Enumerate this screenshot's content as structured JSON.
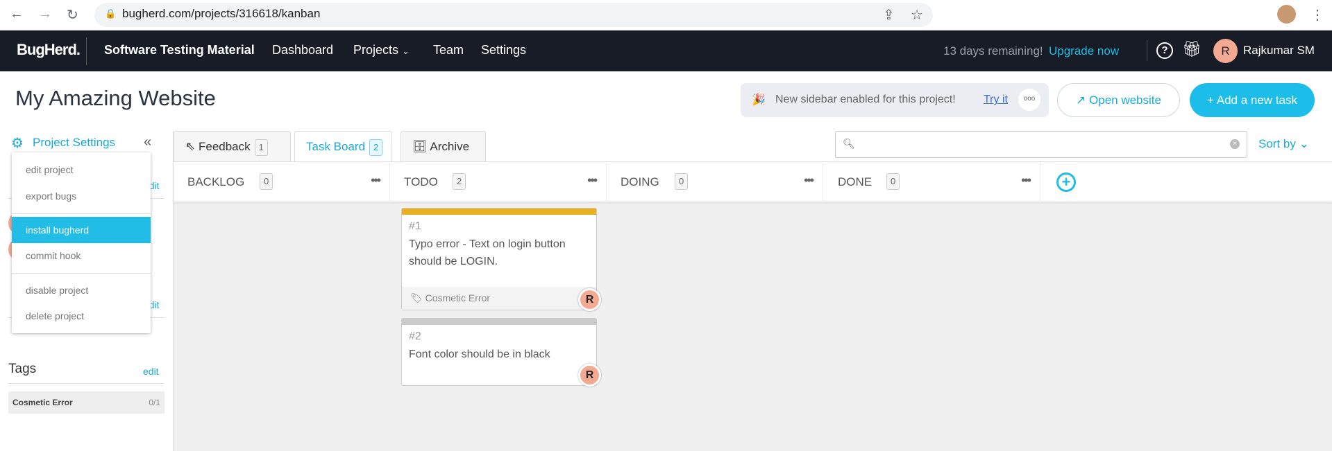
{
  "browser": {
    "url": "bugherd.com/projects/316618/kanban"
  },
  "nav": {
    "logo": "BugHerd.",
    "project": "Software Testing Material",
    "links": [
      "Dashboard",
      "Projects",
      "Team",
      "Settings"
    ],
    "trial": "13 days remaining!",
    "upgrade": "Upgrade now",
    "user_initial": "R",
    "user_name": "Rajkumar SM"
  },
  "header": {
    "title": "My Amazing Website",
    "banner_text": "New sidebar enabled for this project!",
    "banner_link": "Try it",
    "open_website": "Open website",
    "add_task": "+ Add a new task"
  },
  "sidebar": {
    "settings_label": "Project Settings",
    "edit": "edit",
    "tags_title": "Tags",
    "tags": [
      {
        "name": "Cosmetic Error",
        "count": "0/1"
      }
    ]
  },
  "menu": {
    "items": [
      "edit project",
      "export bugs",
      "install bugherd",
      "commit hook",
      "disable project",
      "delete project"
    ],
    "selected": "install bugherd"
  },
  "tabs": [
    {
      "label": "Feedback",
      "count": "1"
    },
    {
      "label": "Task Board",
      "count": "2",
      "active": true
    },
    {
      "label": "Archive"
    }
  ],
  "search": {
    "placeholder": ""
  },
  "sort_label": "Sort by",
  "columns": [
    {
      "name": "BACKLOG",
      "count": "0"
    },
    {
      "name": "TODO",
      "count": "2"
    },
    {
      "name": "DOING",
      "count": "0"
    },
    {
      "name": "DONE",
      "count": "0"
    }
  ],
  "cards": [
    {
      "id": "#1",
      "text": "Typo error - Text on login button should be LOGIN.",
      "tag": "Cosmetic Error",
      "assignee": "R",
      "color": "#e8b020"
    },
    {
      "id": "#2",
      "text": "Font color should be in black",
      "assignee": "R",
      "color": "#cccccc"
    }
  ],
  "colors": {
    "accent": "#1cbde8",
    "nav_bg": "#171c26"
  }
}
